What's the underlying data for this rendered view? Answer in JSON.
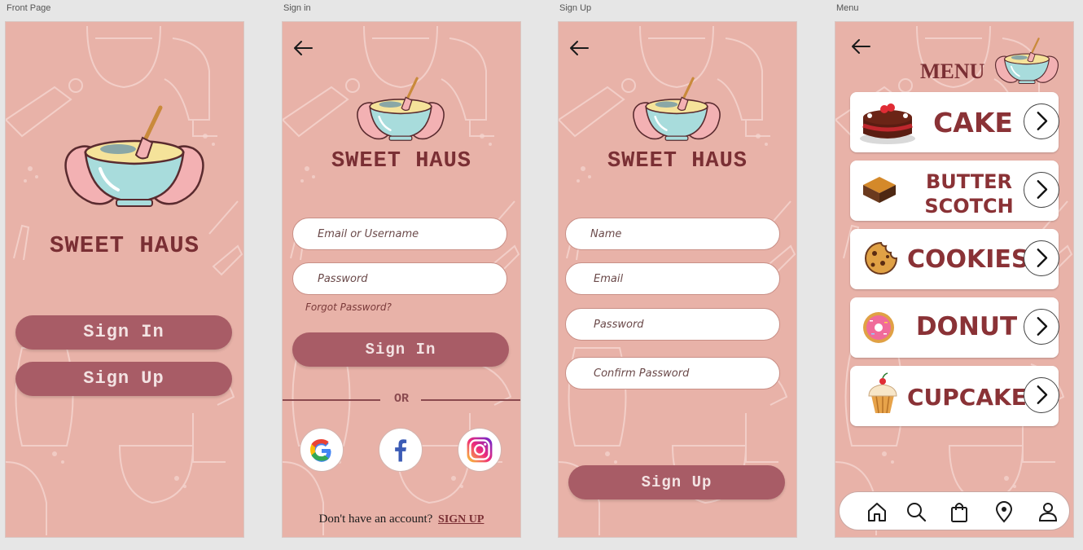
{
  "frames": {
    "front": {
      "label": "Front Page"
    },
    "signin": {
      "label": "Sign in"
    },
    "signup": {
      "label": "Sign Up"
    },
    "menu": {
      "label": "Menu"
    }
  },
  "brand": {
    "name": "SWEET HAUS"
  },
  "front_page": {
    "sign_in_label": "Sign In",
    "sign_up_label": "Sign Up"
  },
  "sign_in_page": {
    "email_placeholder": "Email or Username",
    "password_placeholder": "Password",
    "forgot_password": "Forgot Password?",
    "sign_in_button": "Sign In",
    "or_divider": "OR",
    "no_account_text": "Don't have an account?",
    "sign_up_link": "SIGN UP",
    "socials": [
      "google-icon",
      "facebook-icon",
      "instagram-icon"
    ]
  },
  "sign_up_page": {
    "name_placeholder": "Name",
    "email_placeholder": "Email",
    "password_placeholder": "Password",
    "confirm_placeholder": "Confirm Password",
    "sign_up_button": "Sign Up"
  },
  "menu_page": {
    "title": "MENU",
    "items": [
      {
        "line1": "CAKE",
        "line2": "",
        "icon": "cake-icon"
      },
      {
        "line1": "BUTTER",
        "line2": "SCOTCH",
        "icon": "butterscotch-icon"
      },
      {
        "line1": "COOKIES",
        "line2": "",
        "icon": "cookie-icon"
      },
      {
        "line1": "DONUT",
        "line2": "",
        "icon": "donut-icon"
      },
      {
        "line1": "CUPCAKE",
        "line2": "",
        "icon": "cupcake-icon"
      }
    ],
    "nav": [
      "home-icon",
      "search-icon",
      "bag-icon",
      "location-icon",
      "profile-icon"
    ]
  },
  "colors": {
    "background": "#e8b2a8",
    "button": "#a85c66",
    "brand_text": "#7a2f34"
  }
}
